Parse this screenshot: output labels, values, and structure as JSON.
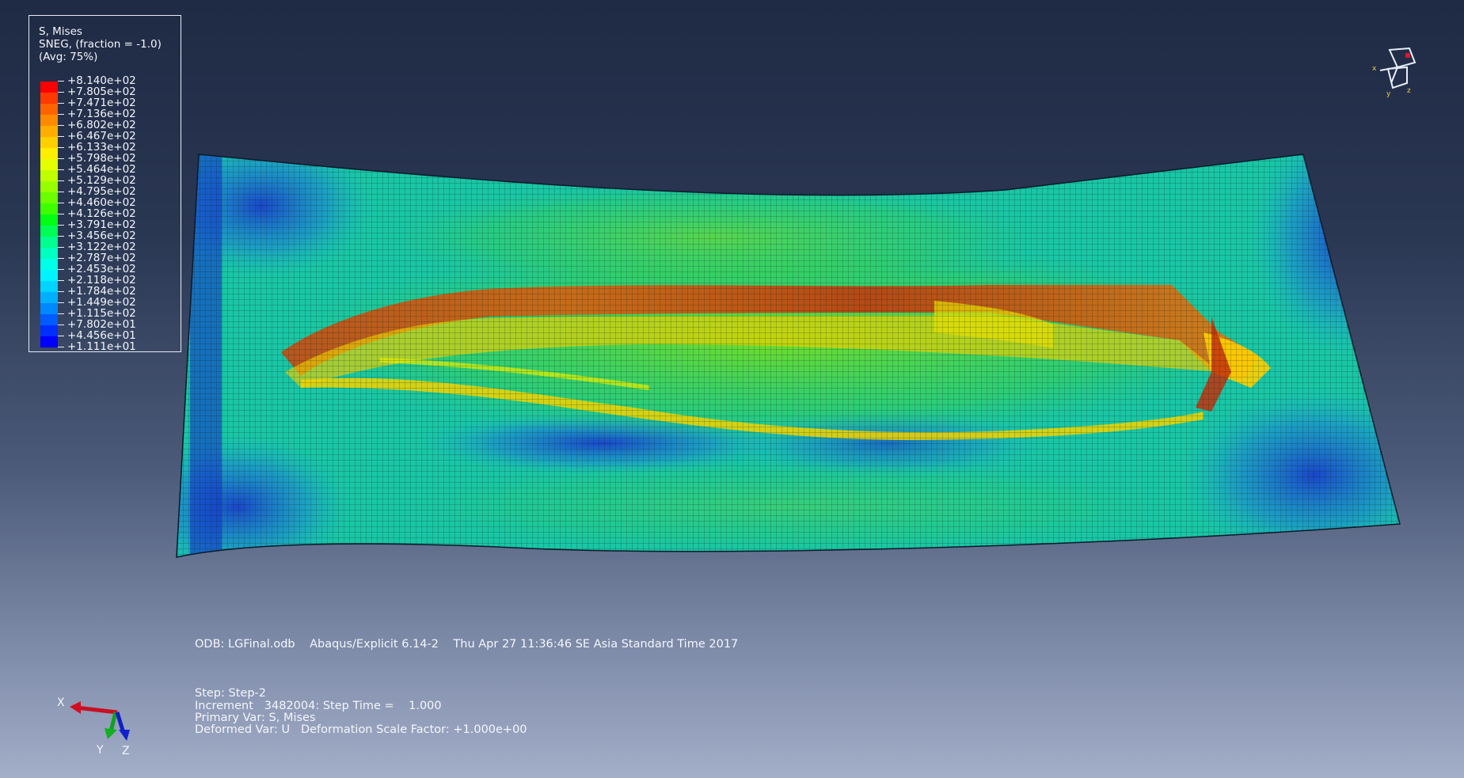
{
  "legend": {
    "title": "S, Mises",
    "subtitle": "SNEG, (fraction = -1.0)",
    "avg": "(Avg: 75%)",
    "values": [
      "+8.140e+02",
      "+7.805e+02",
      "+7.471e+02",
      "+7.136e+02",
      "+6.802e+02",
      "+6.467e+02",
      "+6.133e+02",
      "+5.798e+02",
      "+5.464e+02",
      "+5.129e+02",
      "+4.795e+02",
      "+4.460e+02",
      "+4.126e+02",
      "+3.791e+02",
      "+3.456e+02",
      "+3.122e+02",
      "+2.787e+02",
      "+2.453e+02",
      "+2.118e+02",
      "+1.784e+02",
      "+1.449e+02",
      "+1.115e+02",
      "+7.802e+01",
      "+4.456e+01",
      "+1.111e+01"
    ],
    "colors": [
      "#ff0000",
      "#ff3a00",
      "#ff6300",
      "#ff8a00",
      "#ffae00",
      "#ffcf00",
      "#ffee00",
      "#e6ff00",
      "#bfff00",
      "#97ff00",
      "#6bff00",
      "#3dff00",
      "#00ff12",
      "#00ff55",
      "#00ff8e",
      "#00ffc0",
      "#00ffe6",
      "#00f4ff",
      "#00d4ff",
      "#00b0ff",
      "#0088ff",
      "#005cff",
      "#002eff",
      "#0000ff"
    ]
  },
  "info": {
    "odb": "ODB: LGFinal.odb    Abaqus/Explicit 6.14-2    Thu Apr 27 11:36:46 SE Asia Standard Time 2017",
    "step": "Step: Step-2",
    "increment": "Increment   3482004: Step Time =    1.000",
    "primary": "Primary Var: S, Mises",
    "deformed": "Deformed Var: U   Deformation Scale Factor: +1.000e+00"
  },
  "triad": {
    "x": "X",
    "y": "Y",
    "z": "Z"
  },
  "small_triad": {
    "x": "x",
    "y": "y",
    "z": "z"
  }
}
